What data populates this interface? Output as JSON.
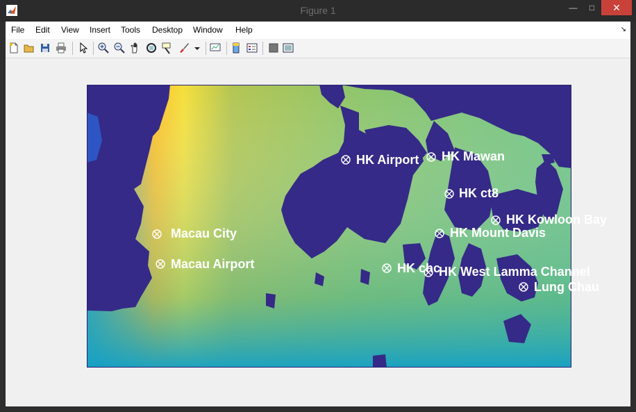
{
  "window": {
    "title": "Figure 1",
    "minimize_glyph": "—",
    "maximize_glyph": "□",
    "close_glyph": "✕"
  },
  "menubar": {
    "items": [
      "File",
      "Edit",
      "View",
      "Insert",
      "Tools",
      "Desktop",
      "Window",
      "Help"
    ],
    "dock_glyph": "↘"
  },
  "toolbar": {
    "icons": [
      "new-figure-icon",
      "open-file-icon",
      "save-icon",
      "print-icon",
      "pointer-icon",
      "zoom-in-icon",
      "zoom-out-icon",
      "pan-icon",
      "rotate-3d-icon",
      "data-cursor-icon",
      "brush-icon",
      "brush-menu-icon",
      "link-plot-icon",
      "colorbar-icon",
      "legend-icon",
      "hide-plot-tools-icon",
      "show-plot-tools-icon"
    ]
  },
  "map": {
    "land_color": "#352a87",
    "colormap": "parula",
    "locations": [
      {
        "name": "HK Airport"
      },
      {
        "name": "HK Mawan"
      },
      {
        "name": "HK ct8"
      },
      {
        "name": "HK Kowloon Bay"
      },
      {
        "name": "HK Mount Davis"
      },
      {
        "name": "Macau City"
      },
      {
        "name": "Macau Airport"
      },
      {
        "name": "HK chc"
      },
      {
        "name": "HK West Lamma Channel"
      },
      {
        "name": "Lung Chau"
      }
    ],
    "marker_symbol": "circle-x",
    "label_color": "#ffffff"
  }
}
